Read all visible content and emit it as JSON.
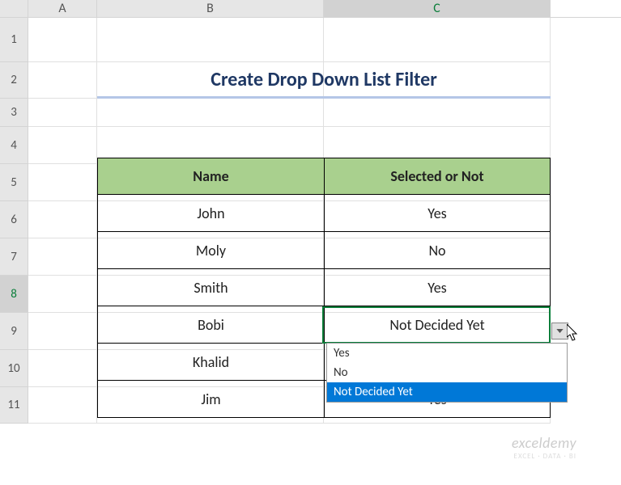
{
  "columns": {
    "a": "A",
    "b": "B",
    "c": "C"
  },
  "rows": {
    "r1": "1",
    "r2": "2",
    "r3": "3",
    "r4": "4",
    "r5": "5",
    "r6": "6",
    "r7": "7",
    "r8": "8",
    "r9": "9",
    "r10": "10",
    "r11": "11"
  },
  "title": "Create Drop Down List Filter",
  "table": {
    "headers": {
      "name": "Name",
      "status": "Selected or Not"
    },
    "rows": [
      {
        "name": "John",
        "status": "Yes"
      },
      {
        "name": "Moly",
        "status": "No"
      },
      {
        "name": "Smith",
        "status": "Yes"
      },
      {
        "name": "Bobi",
        "status": "Not Decided Yet"
      },
      {
        "name": "Khalid",
        "status": ""
      },
      {
        "name": "Jim",
        "status": "Yes"
      }
    ]
  },
  "dropdown": {
    "options": [
      "Yes",
      "No",
      "Not Decided Yet"
    ],
    "selected_index": 2
  },
  "watermark": {
    "brand": "exceldemy",
    "tagline": "EXCEL · DATA · BI"
  }
}
